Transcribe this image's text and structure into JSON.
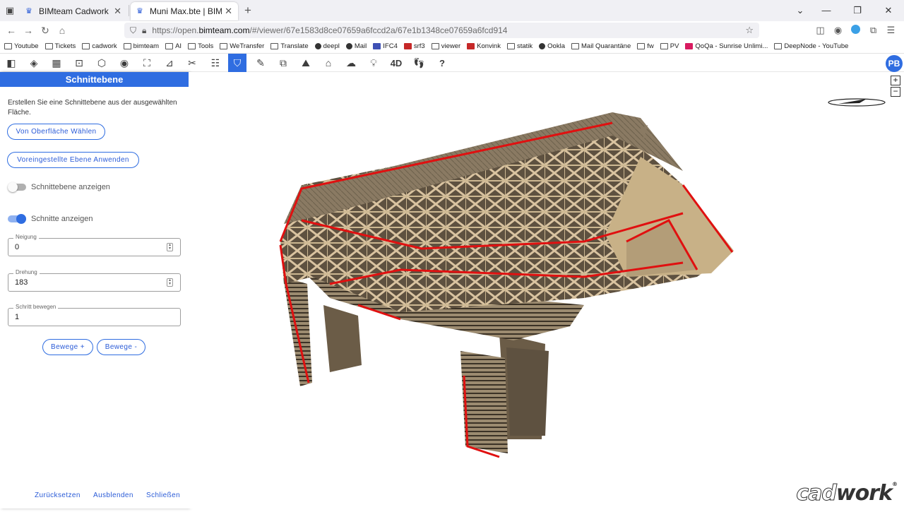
{
  "browser": {
    "tabs": [
      {
        "title": "BIMteam Cadwork",
        "active": false
      },
      {
        "title": "Muni Max.bte | BIMteam Cadwork",
        "active": true
      }
    ],
    "url_prefix": "https://open.",
    "url_host": "bimteam.com",
    "url_path": "/#/viewer/67e1583d8ce07659a6fccd2a/67e1b1348ce07659a6fcd914",
    "bookmarks": [
      "Youtube",
      "Tickets",
      "cadwork",
      "bimteam",
      "AI",
      "Tools",
      "WeTransfer",
      "Translate",
      "deepl",
      "Mail",
      "IFC4",
      "srf3",
      "viewer",
      "Konvink",
      "statik",
      "Ookla",
      "Mail Quarantäne",
      "fw",
      "PV",
      "QoQa - Sunrise Unlimi...",
      "DeepNode - YouTube"
    ]
  },
  "toolbar": {
    "active_tool": "section-plane",
    "four_d_label": "4D",
    "help_label": "?",
    "avatar_initials": "PB"
  },
  "panel": {
    "title": "Schnittebene",
    "description": "Erstellen Sie eine Schnittebene aus der ausgewählten Fläche.",
    "btn_surface": "Von Oberfläche Wählen",
    "btn_preset": "Voreingestellte Ebene Anwenden",
    "toggle_show_plane": {
      "label": "Schnittebene anzeigen",
      "on": false
    },
    "toggle_show_cuts": {
      "label": "Schnitte anzeigen",
      "on": true
    },
    "fields": {
      "neigung": {
        "label": "Neigung",
        "value": "0"
      },
      "drehung": {
        "label": "Drehung",
        "value": "183"
      },
      "schritt": {
        "label": "Schritt bewegen",
        "value": "1"
      }
    },
    "btn_move_plus": "Bewege +",
    "btn_move_minus": "Bewege -",
    "footer": {
      "reset": "Zurücksetzen",
      "hide": "Ausblenden",
      "close": "Schließen"
    }
  },
  "viewport": {
    "zoom_in": "+",
    "zoom_out": "−",
    "brand_light": "cad",
    "brand_dark": "work",
    "brand_reg": "®",
    "colors": {
      "wood": "#8a7a63",
      "wood_light": "#d9c3a0",
      "cut": "#e01010",
      "dark": "#3b3226"
    }
  }
}
